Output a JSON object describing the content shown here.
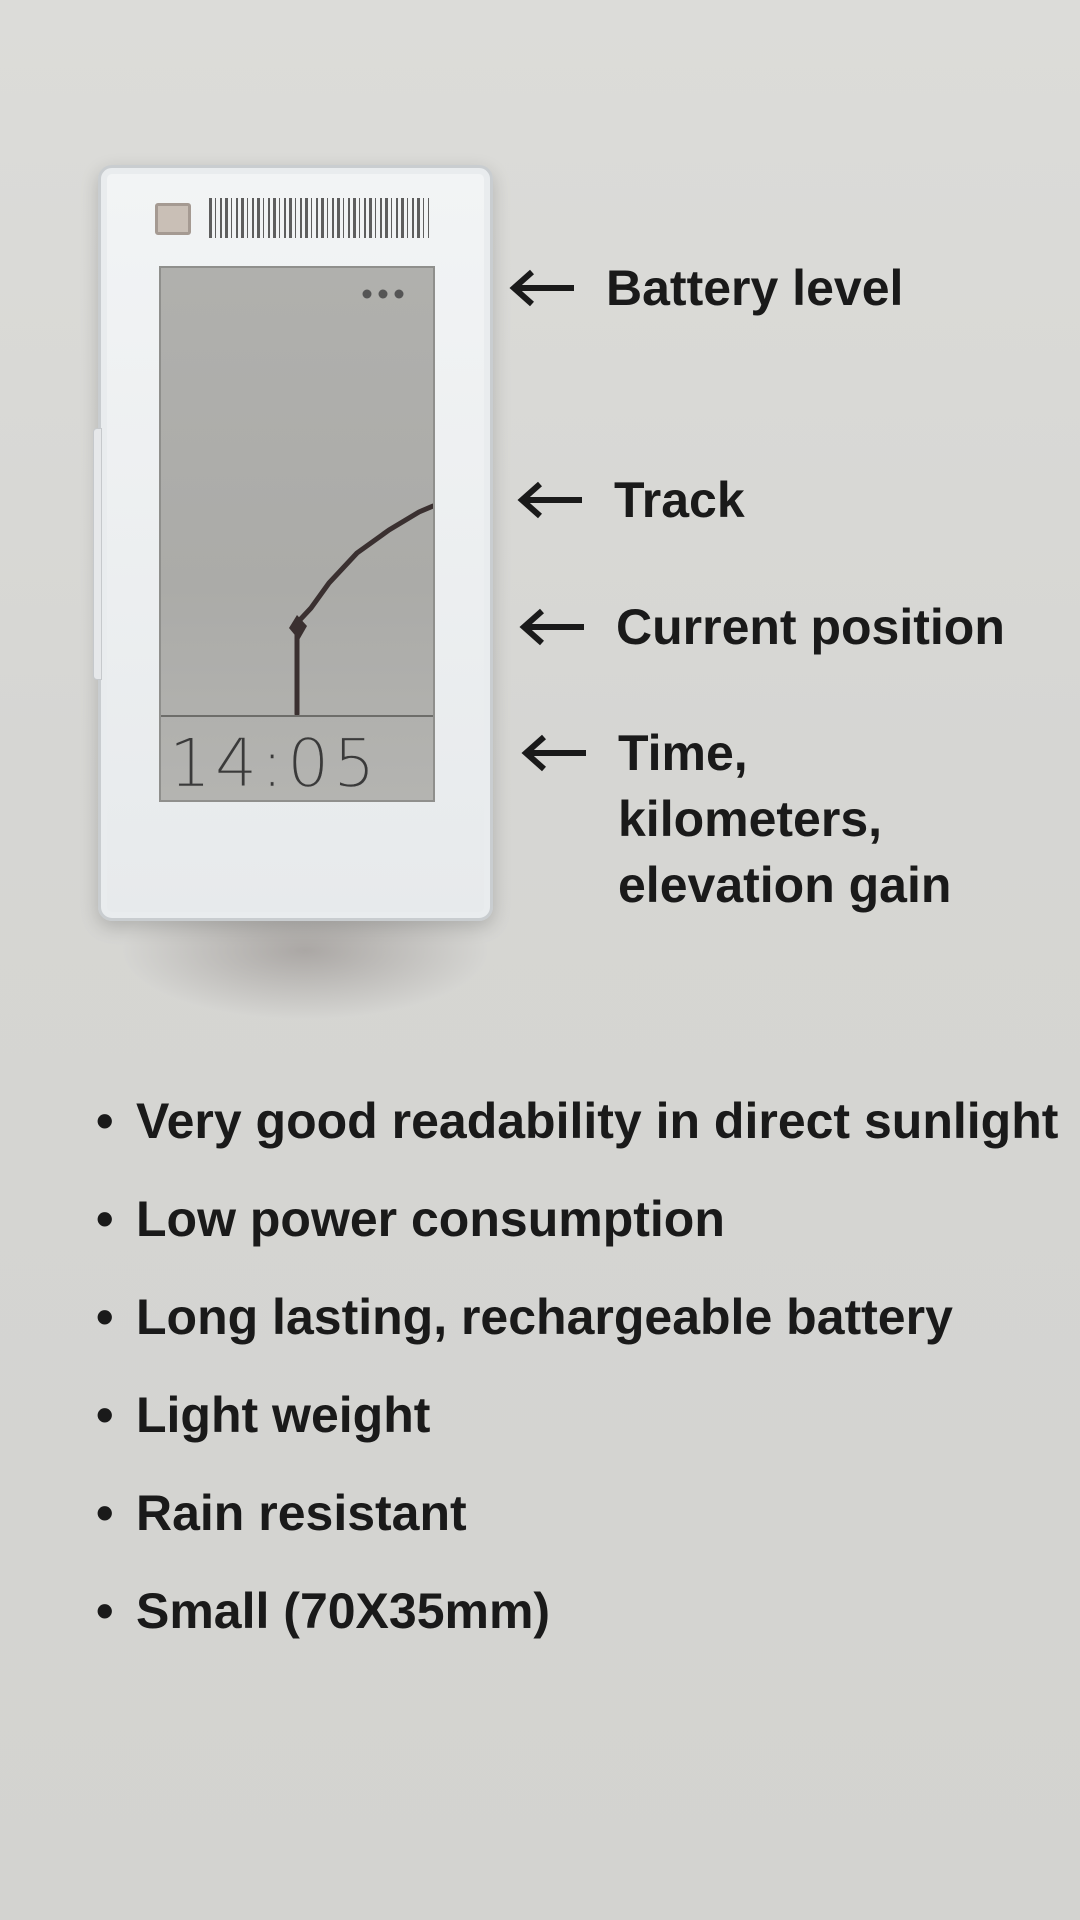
{
  "device": {
    "display_time": "14:05"
  },
  "annotations": [
    {
      "label": "Battery level",
      "icon": "arrow-left-icon"
    },
    {
      "label": "Track",
      "icon": "arrow-left-icon"
    },
    {
      "label": "Current position",
      "icon": "arrow-left-icon"
    },
    {
      "label": "Time,\nkilometers,\nelevation gain",
      "icon": "arrow-left-icon"
    }
  ],
  "features": [
    "Very good readability in direct sunlight",
    "Low power consumption",
    "Long lasting, rechargeable battery",
    "Light weight",
    "Rain resistant",
    "Small (70X35mm)"
  ],
  "colors": {
    "background": "#d8d8d5",
    "device_body": "#eef0f1",
    "screen": "#adadaa",
    "ink": "#1a1a1a"
  }
}
